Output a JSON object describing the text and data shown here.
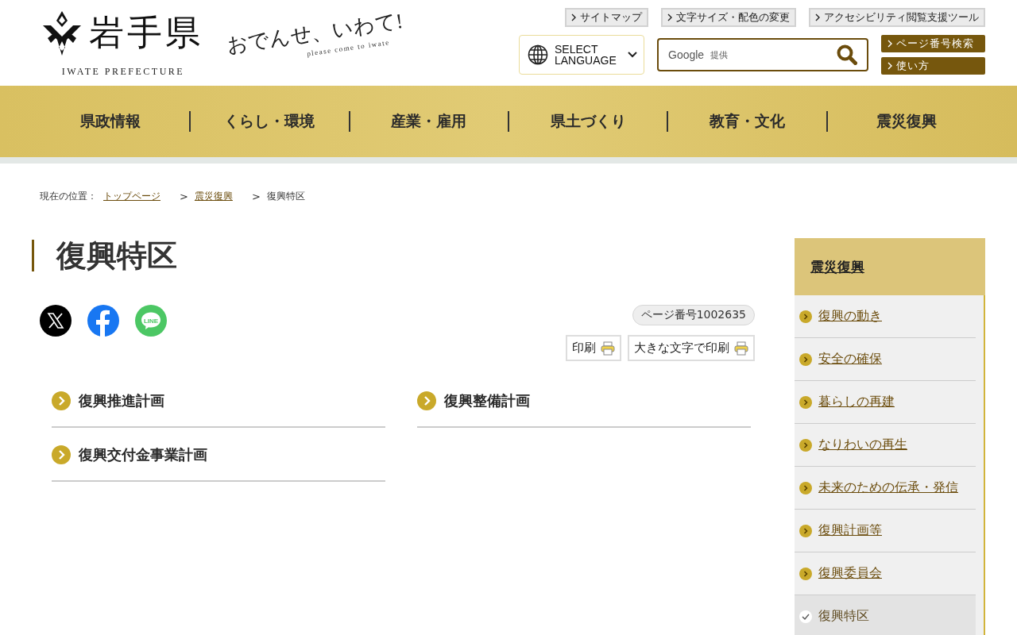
{
  "header": {
    "logo": {
      "name": "岩手県",
      "subtitle": "IWATE PREFECTURE"
    },
    "slogan": {
      "text": "おでんせ、いわて!",
      "subtext": "please come to iwate"
    },
    "utility_links": [
      "サイトマップ",
      "文字サイズ・配色の変更",
      "アクセシビリティ閲覧支援ツール"
    ],
    "language": {
      "label": "SELECT LANGUAGE"
    },
    "search": {
      "provider": "Google",
      "provider_note": "提供"
    },
    "side_buttons": [
      "ページ番号検索",
      "使い方"
    ]
  },
  "nav": [
    "県政情報",
    "くらし・環境",
    "産業・雇用",
    "県土づくり",
    "教育・文化",
    "震災復興"
  ],
  "breadcrumb": {
    "label": "現在の位置：",
    "separator": ">",
    "items": [
      {
        "text": "トップページ",
        "link": true
      },
      {
        "text": "震災復興",
        "link": true
      },
      {
        "text": "復興特区",
        "link": false
      }
    ]
  },
  "page": {
    "title": "復興特区",
    "social": [
      {
        "kind": "x"
      },
      {
        "kind": "facebook"
      },
      {
        "kind": "line",
        "text": "LINE"
      }
    ],
    "page_number": "ページ番号1002635",
    "print_buttons": [
      "印刷",
      "大きな文字で印刷"
    ],
    "links": [
      "復興推進計画",
      "復興整備計画",
      "復興交付金事業計画"
    ]
  },
  "sidebar": {
    "heading": "震災復興",
    "items": [
      {
        "text": "復興の動き",
        "selected": false
      },
      {
        "text": "安全の確保",
        "selected": false
      },
      {
        "text": "暮らしの再建",
        "selected": false
      },
      {
        "text": "なりわいの再生",
        "selected": false
      },
      {
        "text": "未来のための伝承・発信",
        "selected": false
      },
      {
        "text": "復興計画等",
        "selected": false
      },
      {
        "text": "復興委員会",
        "selected": false
      },
      {
        "text": "復興特区",
        "selected": true
      }
    ]
  }
}
